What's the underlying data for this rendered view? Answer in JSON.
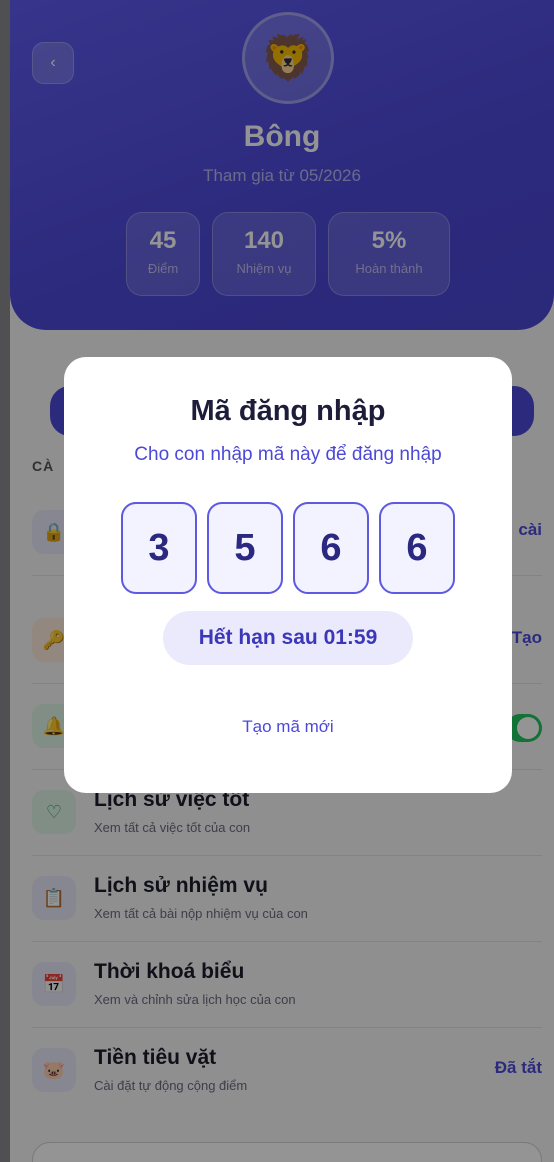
{
  "profile": {
    "back_glyph": "‹",
    "avatar_emoji": "🦁",
    "name": "Bông",
    "joined": "Tham gia từ 05/2026",
    "stats": [
      {
        "value": "45",
        "label": "Điểm"
      },
      {
        "value": "140",
        "label": "Nhiệm vụ"
      },
      {
        "value": "5%",
        "label": "Hoàn thành"
      }
    ]
  },
  "settings": {
    "section_label": "CÀ",
    "rows": [
      {
        "right": "cài"
      },
      {
        "right": "Tạo"
      },
      {
        "toggle_on": true
      },
      {
        "title": "Lịch sử việc tốt",
        "subtitle": "Xem tất cả việc tốt của con"
      },
      {
        "title": "Lịch sử nhiệm vụ",
        "subtitle": "Xem tất cả bài nộp nhiệm vụ của con"
      },
      {
        "title": "Thời khoá biểu",
        "subtitle": "Xem và chỉnh sửa lịch học của con"
      },
      {
        "title": "Tiền tiêu vặt",
        "subtitle": "Cài đặt tự động cộng điểm",
        "right": "Đã tắt"
      }
    ]
  },
  "modal": {
    "title": "Mã đăng nhập",
    "subtitle": "Cho con nhập mã này để đăng nhập",
    "digits": [
      "3",
      "5",
      "6",
      "6"
    ],
    "expiry": "Hết hạn sau 01:59",
    "new_code": "Tạo mã mới"
  },
  "colors": {
    "accent": "#4d49d8",
    "toggle_on": "#22c55e"
  }
}
